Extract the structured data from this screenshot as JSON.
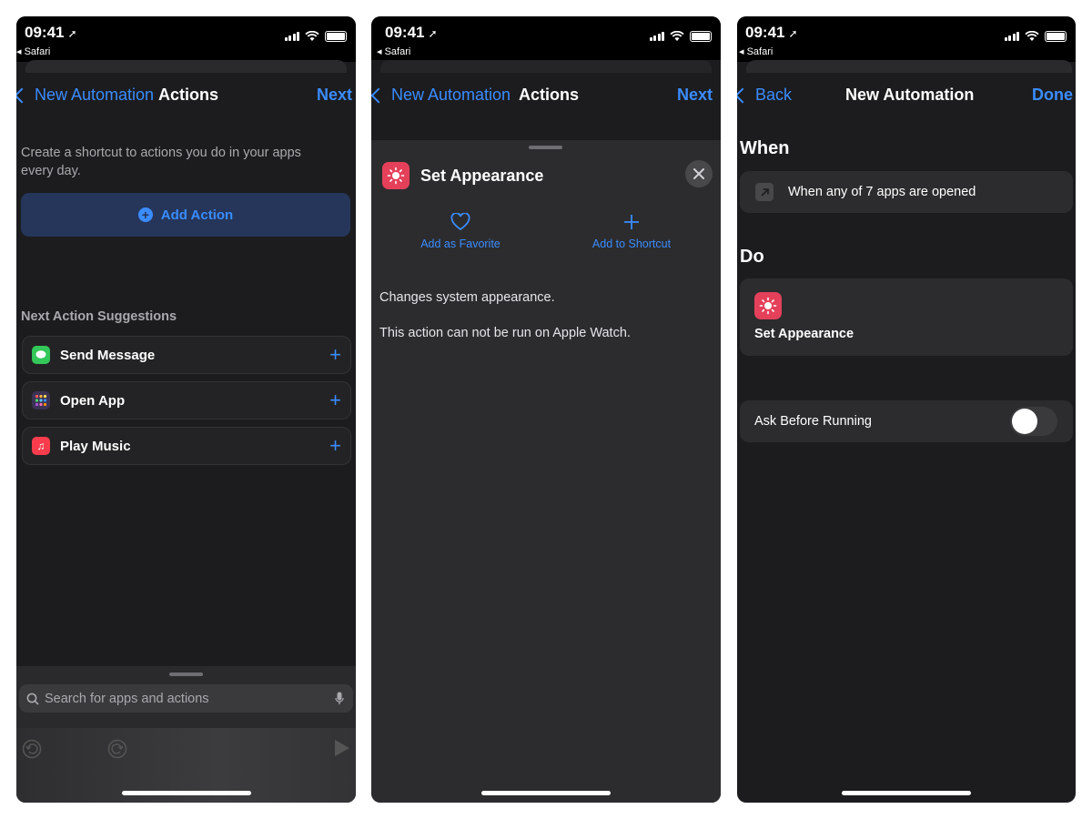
{
  "status": {
    "time": "09:41",
    "back_app": "◂ Safari"
  },
  "colors": {
    "accent": "#3a8cff",
    "background": "#1c1c1e",
    "card": "#2c2c2e",
    "appearance_icon": "#e5405a"
  },
  "screen1": {
    "nav": {
      "back_label": "New Automation",
      "title": "Actions",
      "next_label": "Next"
    },
    "intro": "Create a shortcut to actions you do in your apps every day.",
    "add_action_label": "Add Action",
    "suggestions_heading": "Next Action Suggestions",
    "suggestions": [
      {
        "label": "Send Message",
        "icon": "message-icon",
        "color": "#34c759"
      },
      {
        "label": "Open App",
        "icon": "app-grid-icon",
        "color": "#5a4a8a"
      },
      {
        "label": "Play Music",
        "icon": "music-note-icon",
        "color": "#fa3c4c"
      }
    ],
    "search_placeholder": "Search for apps and actions"
  },
  "screen2": {
    "nav": {
      "back_label": "New Automation",
      "title": "Actions",
      "next_label": "Next"
    },
    "action_title": "Set Appearance",
    "favorite_label": "Add as Favorite",
    "add_shortcut_label": "Add to Shortcut",
    "description": "Changes system appearance.",
    "watch_note": "This action can not be run on Apple Watch."
  },
  "screen3": {
    "nav": {
      "back_label": "Back",
      "title": "New Automation",
      "done_label": "Done"
    },
    "when_heading": "When",
    "trigger_text": "When any of 7 apps are opened",
    "do_heading": "Do",
    "action_label": "Set Appearance",
    "ask_label": "Ask Before Running",
    "ask_enabled": false
  }
}
